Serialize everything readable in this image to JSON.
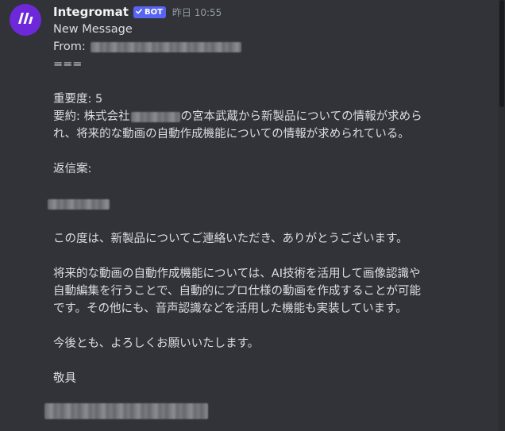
{
  "message": {
    "author": "Integromat",
    "bot_badge": "BOT",
    "timestamp": "昨日 10:55",
    "lines": {
      "title": "New Message",
      "from_label": "From:",
      "separator": "===",
      "importance": "重要度: 5",
      "summary_prefix": "要約: 株式会社",
      "summary_suffix": "の宮本武蔵から新製品についての情報が求めら",
      "summary_line2": "れ、将来的な動画の自動作成機能についての情報が求められている。",
      "reply_heading": "返信案:",
      "body_1": "この度は、新製品についてご連絡いただき、ありがとうございます。",
      "body_2a": "将来的な動画の自動作成機能については、AI技術を活用して画像認識や",
      "body_2b": "自動編集を行うことで、自動的にプロ仕様の動画を作成することが可能",
      "body_2c": "です。その他にも、音声認識などを活用した機能も実装しています。",
      "body_3": "今後とも、よろしくお願いいたします。",
      "closing": "敬具"
    }
  },
  "colors": {
    "background": "#313338",
    "text": "#dbdee1",
    "username": "#f2f3f5",
    "timestamp": "#949ba4",
    "bot_badge": "#5865f2",
    "avatar": "#6d28d9"
  },
  "icons": {
    "avatar": "make-logo-icon",
    "badge_check": "checkmark-icon"
  }
}
